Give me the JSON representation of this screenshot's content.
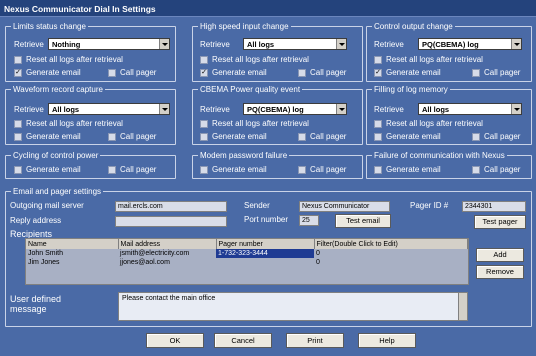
{
  "window": {
    "title": "Nexus Communicator Dial In Settings"
  },
  "labels": {
    "retrieve": "Retrieve",
    "reset": "Reset all logs after retrieval",
    "generate_email": "Generate email",
    "call_pager": "Call pager"
  },
  "groups": [
    {
      "title": "Limits status change",
      "retrieve_value": "Nothing",
      "reset": false,
      "email": true,
      "pager": false
    },
    {
      "title": "High speed input change",
      "retrieve_value": "All logs",
      "reset": false,
      "email": true,
      "pager": false
    },
    {
      "title": "Control output change",
      "retrieve_value": "PQ(CBEMA) log",
      "reset": false,
      "email": true,
      "pager": false
    },
    {
      "title": "Waveform record capture",
      "retrieve_value": "All logs",
      "reset": false,
      "email": false,
      "pager": false
    },
    {
      "title": "CBEMA Power quality event",
      "retrieve_value": "PQ(CBEMA) log",
      "reset": false,
      "email": false,
      "pager": false
    },
    {
      "title": "Filling of log memory",
      "retrieve_value": "All logs",
      "reset": false,
      "email": false,
      "pager": false
    },
    {
      "title": "Cycling of control power",
      "email": false,
      "pager": false
    },
    {
      "title": "Modem password failure",
      "email": false,
      "pager": false
    },
    {
      "title": "Failure of communication with Nexus",
      "email": false,
      "pager": false
    }
  ],
  "email_pager": {
    "title": "Email and pager settings",
    "outgoing_label": "Outgoing mail server",
    "outgoing_value": "mail.ercls.com",
    "reply_label": "Reply address",
    "reply_value": "",
    "sender_label": "Sender",
    "sender_value": "Nexus Communicator",
    "port_label": "Port number",
    "port_value": "25",
    "test_email": "Test email",
    "pager_label": "Pager ID #",
    "pager_value": "2344301",
    "test_pager": "Test pager"
  },
  "recipients": {
    "title": "Recipients",
    "columns": [
      "Name",
      "Mail address",
      "Pager number",
      "Filter(Double Click to Edit)"
    ],
    "rows": [
      [
        "John Smith",
        "jsmith@electricity.com",
        "1-732-323-3444",
        "0"
      ],
      [
        "Jim Jones",
        "jjones@aol.com",
        "",
        "0"
      ]
    ],
    "add": "Add",
    "remove": "Remove"
  },
  "message": {
    "label_line1": "User defined",
    "label_line2": "message",
    "value": "Please contact the main office"
  },
  "buttons": {
    "ok": "OK",
    "cancel": "Cancel",
    "print": "Print",
    "help": "Help"
  },
  "colors": {
    "background": "#4a6aa6",
    "titlebar": "#24437c",
    "selection": "#1f3b93"
  }
}
